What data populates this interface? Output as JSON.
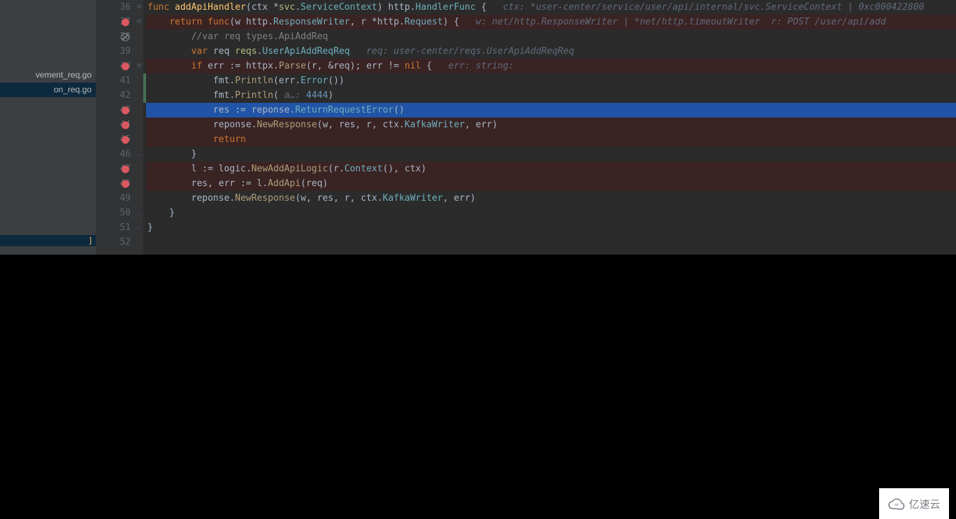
{
  "sidebar": {
    "files": [
      {
        "name": "vement_req.go"
      },
      {
        "name": "on_req.go"
      }
    ],
    "otherLabel": "]"
  },
  "gutter": {
    "start": 36,
    "rows": [
      {
        "n": 36,
        "marker": "none",
        "fold": "open"
      },
      {
        "n": 37,
        "marker": "bp",
        "fold": "open"
      },
      {
        "n": 38,
        "marker": "no",
        "fold": ""
      },
      {
        "n": 39,
        "marker": "none",
        "fold": ""
      },
      {
        "n": 40,
        "marker": "bp",
        "fold": "open"
      },
      {
        "n": 41,
        "marker": "none",
        "fold": ""
      },
      {
        "n": 42,
        "marker": "none",
        "fold": ""
      },
      {
        "n": 43,
        "marker": "bp",
        "fold": ""
      },
      {
        "n": 44,
        "marker": "bp",
        "fold": ""
      },
      {
        "n": 45,
        "marker": "bp",
        "fold": ""
      },
      {
        "n": 46,
        "marker": "none",
        "fold": "close"
      },
      {
        "n": 47,
        "marker": "bp",
        "fold": ""
      },
      {
        "n": 48,
        "marker": "bp",
        "fold": ""
      },
      {
        "n": 49,
        "marker": "none",
        "fold": ""
      },
      {
        "n": 50,
        "marker": "none",
        "fold": "close"
      },
      {
        "n": 51,
        "marker": "none",
        "fold": "close"
      },
      {
        "n": 52,
        "marker": "none",
        "fold": ""
      }
    ]
  },
  "code": {
    "lines": [
      {
        "bp": false,
        "exec": false,
        "tokens": [
          {
            "t": "func ",
            "c": "kw"
          },
          {
            "t": "addApiHandler",
            "c": "fnname"
          },
          {
            "t": "(ctx *",
            "c": "op"
          },
          {
            "t": "svc",
            "c": "pkg"
          },
          {
            "t": ".",
            "c": "op"
          },
          {
            "t": "ServiceContext",
            "c": "type"
          },
          {
            "t": ") ",
            "c": "op"
          },
          {
            "t": "http",
            "c": "pkg2"
          },
          {
            "t": ".",
            "c": "op"
          },
          {
            "t": "HandlerFunc",
            "c": "type"
          },
          {
            "t": " {   ",
            "c": "op"
          },
          {
            "t": "ctx: *user-center/service/user/api/internal/svc.ServiceContext | 0xc000422800",
            "c": "hint"
          }
        ]
      },
      {
        "bp": true,
        "exec": false,
        "tokens": [
          {
            "t": "    ",
            "c": "op"
          },
          {
            "t": "return func",
            "c": "kw"
          },
          {
            "t": "(w ",
            "c": "op"
          },
          {
            "t": "http",
            "c": "pkg2"
          },
          {
            "t": ".",
            "c": "op"
          },
          {
            "t": "ResponseWriter",
            "c": "type"
          },
          {
            "t": ", r *",
            "c": "op"
          },
          {
            "t": "http",
            "c": "pkg2"
          },
          {
            "t": ".",
            "c": "op"
          },
          {
            "t": "Request",
            "c": "type"
          },
          {
            "t": ") {   ",
            "c": "op"
          },
          {
            "t": "w: net/http.ResponseWriter | *net/http.timeoutWriter  r: POST /user/api/add",
            "c": "hint"
          }
        ]
      },
      {
        "bp": false,
        "exec": false,
        "tokens": [
          {
            "t": "        ",
            "c": "op"
          },
          {
            "t": "//var req types.ApiAddReq",
            "c": "cmt"
          }
        ]
      },
      {
        "bp": false,
        "exec": false,
        "tokens": [
          {
            "t": "        ",
            "c": "op"
          },
          {
            "t": "var ",
            "c": "kw"
          },
          {
            "t": "req ",
            "c": "ident"
          },
          {
            "t": "reqs",
            "c": "pkg"
          },
          {
            "t": ".",
            "c": "op"
          },
          {
            "t": "UserApiAddReqReq",
            "c": "type"
          },
          {
            "t": "   ",
            "c": "op"
          },
          {
            "t": "req: user-center/reqs.UserApiAddReqReq",
            "c": "hint"
          }
        ]
      },
      {
        "bp": true,
        "exec": false,
        "tokens": [
          {
            "t": "        ",
            "c": "op"
          },
          {
            "t": "if ",
            "c": "kw"
          },
          {
            "t": "err := ",
            "c": "ident"
          },
          {
            "t": "httpx",
            "c": "pkg2"
          },
          {
            "t": ".",
            "c": "op"
          },
          {
            "t": "Parse",
            "c": "call"
          },
          {
            "t": "(r, &req); err != ",
            "c": "ident"
          },
          {
            "t": "nil",
            "c": "kw"
          },
          {
            "t": " {   ",
            "c": "op"
          },
          {
            "t": "err: string:",
            "c": "hint"
          }
        ]
      },
      {
        "bp": false,
        "exec": false,
        "tokens": [
          {
            "t": "            ",
            "c": "op"
          },
          {
            "t": "fmt",
            "c": "pkg2"
          },
          {
            "t": ".",
            "c": "op"
          },
          {
            "t": "Println",
            "c": "call"
          },
          {
            "t": "(err.",
            "c": "ident"
          },
          {
            "t": "Error",
            "c": "type"
          },
          {
            "t": "())",
            "c": "op"
          }
        ]
      },
      {
        "bp": false,
        "exec": false,
        "tokens": [
          {
            "t": "            ",
            "c": "op"
          },
          {
            "t": "fmt",
            "c": "pkg2"
          },
          {
            "t": ".",
            "c": "op"
          },
          {
            "t": "Println",
            "c": "call"
          },
          {
            "t": "( ",
            "c": "op"
          },
          {
            "t": "a…: ",
            "c": "hint"
          },
          {
            "t": "4444",
            "c": "num"
          },
          {
            "t": ")",
            "c": "op"
          }
        ]
      },
      {
        "bp": true,
        "exec": true,
        "tokens": [
          {
            "t": "            res := ",
            "c": "ident"
          },
          {
            "t": "reponse",
            "c": "pkg2"
          },
          {
            "t": ".",
            "c": "op"
          },
          {
            "t": "ReturnRequestError",
            "c": "type"
          },
          {
            "t": "()",
            "c": "op"
          }
        ]
      },
      {
        "bp": true,
        "exec": false,
        "tokens": [
          {
            "t": "            ",
            "c": "op"
          },
          {
            "t": "reponse",
            "c": "pkg2"
          },
          {
            "t": ".",
            "c": "op"
          },
          {
            "t": "NewResponse",
            "c": "call"
          },
          {
            "t": "(w, res, r, ctx.",
            "c": "ident"
          },
          {
            "t": "KafkaWriter",
            "c": "type"
          },
          {
            "t": ", err)",
            "c": "ident"
          }
        ]
      },
      {
        "bp": true,
        "exec": false,
        "tokens": [
          {
            "t": "            ",
            "c": "op"
          },
          {
            "t": "return",
            "c": "kw"
          }
        ]
      },
      {
        "bp": false,
        "exec": false,
        "tokens": [
          {
            "t": "        }",
            "c": "op"
          }
        ]
      },
      {
        "bp": true,
        "exec": false,
        "tokens": [
          {
            "t": "        l := ",
            "c": "ident"
          },
          {
            "t": "logic",
            "c": "pkg2"
          },
          {
            "t": ".",
            "c": "op"
          },
          {
            "t": "NewAddApiLogic",
            "c": "call"
          },
          {
            "t": "(r.",
            "c": "ident"
          },
          {
            "t": "Context",
            "c": "type"
          },
          {
            "t": "(), ctx)",
            "c": "ident"
          }
        ]
      },
      {
        "bp": true,
        "exec": false,
        "tokens": [
          {
            "t": "        res, err := l.",
            "c": "ident"
          },
          {
            "t": "AddApi",
            "c": "call"
          },
          {
            "t": "(req)",
            "c": "ident"
          }
        ]
      },
      {
        "bp": false,
        "exec": false,
        "tokens": [
          {
            "t": "        ",
            "c": "op"
          },
          {
            "t": "reponse",
            "c": "pkg2"
          },
          {
            "t": ".",
            "c": "op"
          },
          {
            "t": "NewResponse",
            "c": "call"
          },
          {
            "t": "(w, res, r, ctx.",
            "c": "ident"
          },
          {
            "t": "KafkaWriter",
            "c": "type"
          },
          {
            "t": ", err)",
            "c": "ident"
          }
        ]
      },
      {
        "bp": false,
        "exec": false,
        "tokens": [
          {
            "t": "    }",
            "c": "op"
          }
        ]
      },
      {
        "bp": false,
        "exec": false,
        "tokens": [
          {
            "t": "}",
            "c": "op"
          }
        ]
      },
      {
        "bp": false,
        "exec": false,
        "tokens": [
          {
            "t": "",
            "c": "op"
          }
        ]
      }
    ]
  },
  "watermark": {
    "text": "亿速云"
  }
}
